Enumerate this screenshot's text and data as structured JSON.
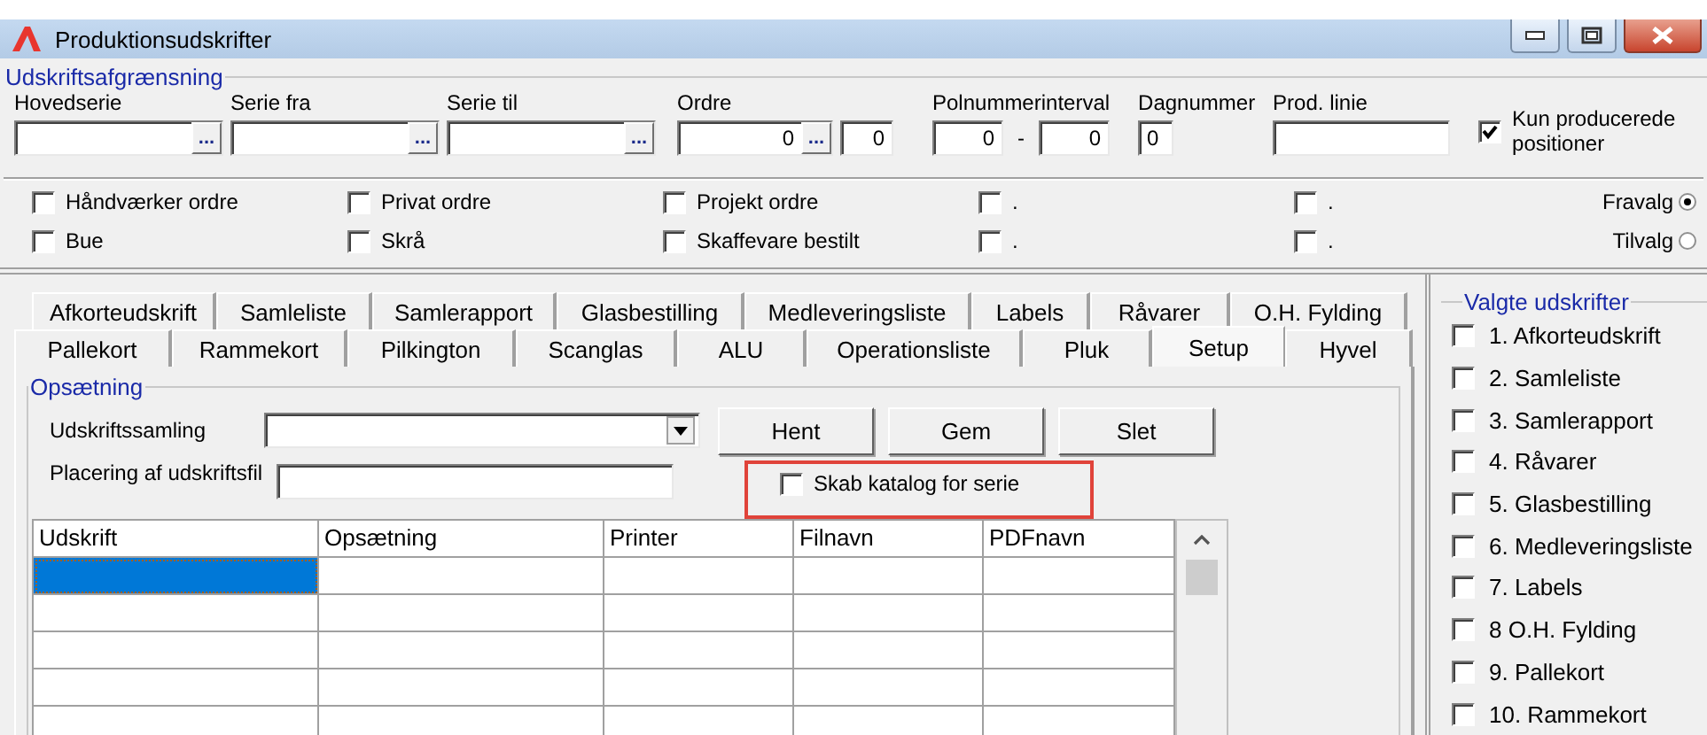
{
  "window": {
    "title": "Produktionsudskrifter"
  },
  "filter": {
    "legend": "Udskriftsafgrænsning",
    "fields": [
      {
        "label": "Hovedserie",
        "kind": "lookup",
        "button": "..."
      },
      {
        "label": "Serie fra",
        "kind": "lookup",
        "button": "..."
      },
      {
        "label": "Serie til",
        "kind": "lookup",
        "button": "..."
      },
      {
        "label": "Ordre",
        "kind": "lookup",
        "value": "0",
        "button": "..."
      },
      {
        "kind": "text",
        "value": "0"
      },
      {
        "label": "Polnummerinterval",
        "kind": "range",
        "from": "0",
        "separator": "-",
        "to": "0"
      },
      {
        "label": "Dagnummer",
        "kind": "text",
        "value": "0"
      },
      {
        "label": "Prod. linie",
        "kind": "text"
      }
    ],
    "only_produced": {
      "label": "Kun producerede positioner",
      "checked": true
    }
  },
  "options": [
    {
      "label": "Håndværker ordre",
      "checked": false
    },
    {
      "label": "Privat ordre",
      "checked": false
    },
    {
      "label": "Projekt ordre",
      "checked": false
    },
    {
      "label": ".",
      "checked": false
    },
    {
      "label": ".",
      "checked": false
    },
    {
      "label": "Bue",
      "checked": false
    },
    {
      "label": "Skrå",
      "checked": false
    },
    {
      "label": "Skaffevare bestilt",
      "checked": false
    },
    {
      "label": ".",
      "checked": false
    },
    {
      "label": ".",
      "checked": false
    }
  ],
  "mode": [
    {
      "label": "Fravalg",
      "selected": true
    },
    {
      "label": "Tilvalg",
      "selected": false
    }
  ],
  "tab_rows": [
    {
      "tabs": [
        {
          "label": "Afkorteudskrift",
          "selected": false
        },
        {
          "label": "Samleliste",
          "selected": false
        },
        {
          "label": "Samlerapport",
          "selected": false
        },
        {
          "label": "Glasbestilling",
          "selected": false
        },
        {
          "label": "Medleveringsliste",
          "selected": false
        },
        {
          "label": "Labels",
          "selected": false
        },
        {
          "label": "Råvarer",
          "selected": false
        },
        {
          "label": "O.H. Fylding",
          "selected": false
        }
      ]
    },
    {
      "tabs": [
        {
          "label": "Pallekort",
          "selected": false
        },
        {
          "label": "Rammekort",
          "selected": false
        },
        {
          "label": "Pilkington",
          "selected": false
        },
        {
          "label": "Scanglas",
          "selected": false
        },
        {
          "label": "ALU",
          "selected": false
        },
        {
          "label": "Operationsliste",
          "selected": false
        },
        {
          "label": "Pluk",
          "selected": false
        },
        {
          "label": "Setup",
          "selected": true
        },
        {
          "label": "Hyvel",
          "selected": false
        }
      ]
    }
  ],
  "setup": {
    "legend": "Opsætning",
    "collection": {
      "label": "Udskriftssamling"
    },
    "buttons": [
      "Hent",
      "Gem",
      "Slet"
    ],
    "file_location": {
      "label": "Placering af udskriftsfil"
    },
    "catalog": {
      "label": "Skab katalog for serie",
      "checked": false,
      "highlighted": true
    },
    "table": {
      "columns": [
        "Udskrift",
        "Opsætning",
        "Printer",
        "Filnavn",
        "PDFnavn"
      ],
      "rows": [
        {
          "selected": true
        },
        {
          "selected": false
        },
        {
          "selected": false
        },
        {
          "selected": false
        },
        {
          "selected": false
        }
      ]
    }
  },
  "selected_prints": {
    "legend": "Valgte udskrifter",
    "items": [
      {
        "label": "1. Afkorteudskrift",
        "checked": false
      },
      {
        "label": "2. Samleliste",
        "checked": false
      },
      {
        "label": "3. Samlerapport",
        "checked": false
      },
      {
        "label": "4. Råvarer",
        "checked": false
      },
      {
        "label": "5. Glasbestilling",
        "checked": false
      },
      {
        "label": "6. Medleveringsliste",
        "checked": false
      },
      {
        "label": "7. Labels",
        "checked": false
      },
      {
        "label": "8 O.H. Fylding",
        "checked": false
      },
      {
        "label": "9. Pallekort",
        "checked": false
      },
      {
        "label": "10. Rammekort",
        "checked": false
      }
    ]
  }
}
